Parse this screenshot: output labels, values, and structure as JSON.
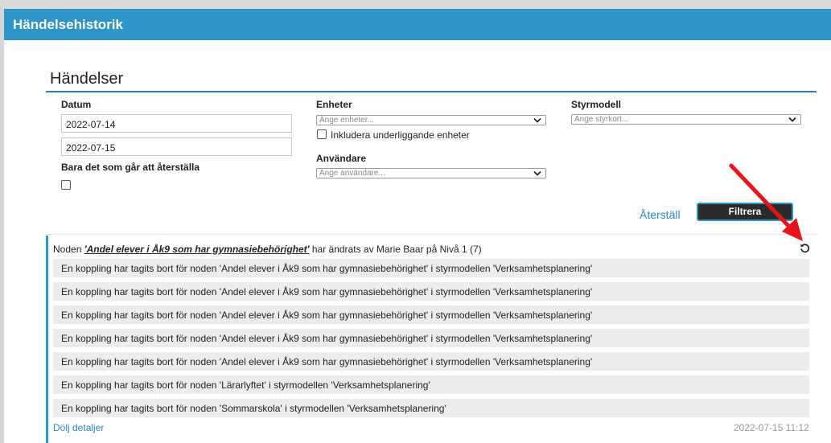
{
  "window": {
    "title": "Händelsehistorik"
  },
  "section": {
    "title": "Händelser"
  },
  "filters": {
    "datum_label": "Datum",
    "date_from": "2022-07-14",
    "date_to": "2022-07-15",
    "restorable_label": "Bara det som går att återställa",
    "enheter_label": "Enheter",
    "enheter_placeholder": "Ange enheter...",
    "include_sub_label": "Inkludera underliggande enheter",
    "anvandare_label": "Användare",
    "anvandare_placeholder": "Ange användare...",
    "styrmodell_label": "Styrmodell",
    "styrmodell_placeholder": "Ange styrkort...",
    "reset_label": "Återställ",
    "filter_label": "Filtrera"
  },
  "event": {
    "prefix": "Noden",
    "node_name": "'Andel elever i Åk9 som har gymnasiebehörighet'",
    "suffix": "har ändrats av Marie Baar på Nivå 1 (7)",
    "details": [
      "En koppling har tagits bort för noden 'Andel elever i Åk9 som har gymnasiebehörighet' i styrmodellen 'Verksamhetsplanering'",
      "En koppling har tagits bort för noden 'Andel elever i Åk9 som har gymnasiebehörighet' i styrmodellen 'Verksamhetsplanering'",
      "En koppling har tagits bort för noden 'Andel elever i Åk9 som har gymnasiebehörighet' i styrmodellen 'Verksamhetsplanering'",
      "En koppling har tagits bort för noden 'Andel elever i Åk9 som har gymnasiebehörighet' i styrmodellen 'Verksamhetsplanering'",
      "En koppling har tagits bort för noden 'Andel elever i Åk9 som har gymnasiebehörighet' i styrmodellen 'Verksamhetsplanering'",
      "En koppling har tagits bort för noden 'Lärarlyftet' i styrmodellen 'Verksamhetsplanering'",
      "En koppling har tagits bort för noden 'Sommarskola' i styrmodellen 'Verksamhetsplanering'"
    ],
    "hide_details_label": "Dölj detaljer",
    "timestamp": "2022-07-15 11:12"
  },
  "colors": {
    "titlebar": "#2e95c6",
    "link": "#2e86c1",
    "annotation_arrow": "#e8141c"
  }
}
